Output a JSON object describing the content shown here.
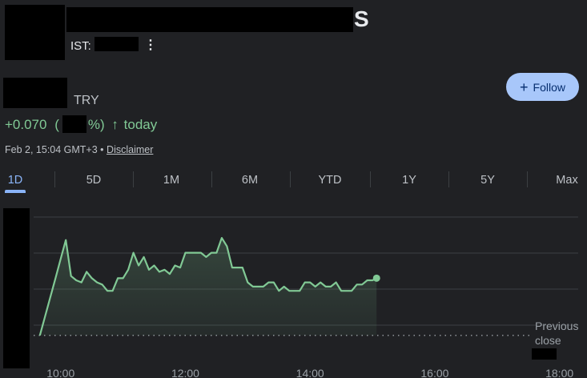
{
  "header": {
    "title_visible_suffix": "S",
    "exchange_label": "IST:",
    "more_icon": "more-vert-icon"
  },
  "price": {
    "currency": "TRY"
  },
  "follow_button": {
    "label": "Follow",
    "icon": "plus-icon"
  },
  "change": {
    "abs": "+0.070",
    "open_paren": "(",
    "close_pct": "%)",
    "arrow": "↑",
    "period": "today",
    "color": "#81c995"
  },
  "meta": {
    "timestamp": "Feb 2, 15:04 GMT+3",
    "separator": "•",
    "disclaimer": "Disclaimer"
  },
  "tabs": {
    "items": [
      "1D",
      "5D",
      "1M",
      "6M",
      "YTD",
      "1Y",
      "5Y",
      "Max"
    ],
    "selected": "1D",
    "accent": "#8ab4f8"
  },
  "chart_data": {
    "type": "area",
    "x_ticks": [
      "10:00",
      "12:00",
      "14:00",
      "16:00",
      "18:00"
    ],
    "previous_close_label": [
      "Previous",
      "close"
    ],
    "line_color": "#81c995",
    "x": [
      "09:40",
      "09:45",
      "09:50",
      "09:55",
      "10:00",
      "10:05",
      "10:10",
      "10:15",
      "10:20",
      "10:25",
      "10:30",
      "10:35",
      "10:40",
      "10:45",
      "10:50",
      "10:55",
      "11:00",
      "11:05",
      "11:10",
      "11:15",
      "11:20",
      "11:25",
      "11:30",
      "11:35",
      "11:40",
      "11:45",
      "11:50",
      "11:55",
      "12:00",
      "12:05",
      "12:10",
      "12:15",
      "12:20",
      "12:25",
      "12:30",
      "12:35",
      "12:40",
      "12:45",
      "12:50",
      "12:55",
      "13:00",
      "13:05",
      "13:10",
      "13:15",
      "13:20",
      "13:25",
      "13:30",
      "13:35",
      "13:40",
      "13:45",
      "13:50",
      "13:55",
      "14:00",
      "14:05",
      "14:10",
      "14:15",
      "14:20",
      "14:25",
      "14:30",
      "14:35",
      "14:40",
      "14:45",
      "14:50",
      "14:55",
      "15:00",
      "15:04"
    ],
    "y": [
      0.0,
      0.45,
      0.9,
      1.35,
      1.8,
      2.25,
      1.4,
      1.3,
      1.25,
      1.5,
      1.35,
      1.25,
      1.2,
      1.05,
      1.05,
      1.35,
      1.35,
      1.55,
      1.95,
      1.65,
      1.85,
      1.55,
      1.65,
      1.5,
      1.55,
      1.45,
      1.65,
      1.6,
      1.95,
      1.95,
      1.95,
      1.95,
      1.85,
      1.95,
      1.95,
      2.3,
      2.1,
      1.6,
      1.6,
      1.6,
      1.25,
      1.15,
      1.15,
      1.15,
      1.25,
      1.25,
      1.05,
      1.15,
      1.05,
      1.05,
      1.05,
      1.25,
      1.25,
      1.15,
      1.25,
      1.15,
      1.15,
      1.25,
      1.05,
      1.05,
      1.05,
      1.2,
      1.2,
      1.3,
      1.3,
      1.35
    ],
    "previous_close": 0.0,
    "ylim": [
      -0.4,
      3.0
    ],
    "xlim_minutes": [
      574,
      1098
    ]
  }
}
